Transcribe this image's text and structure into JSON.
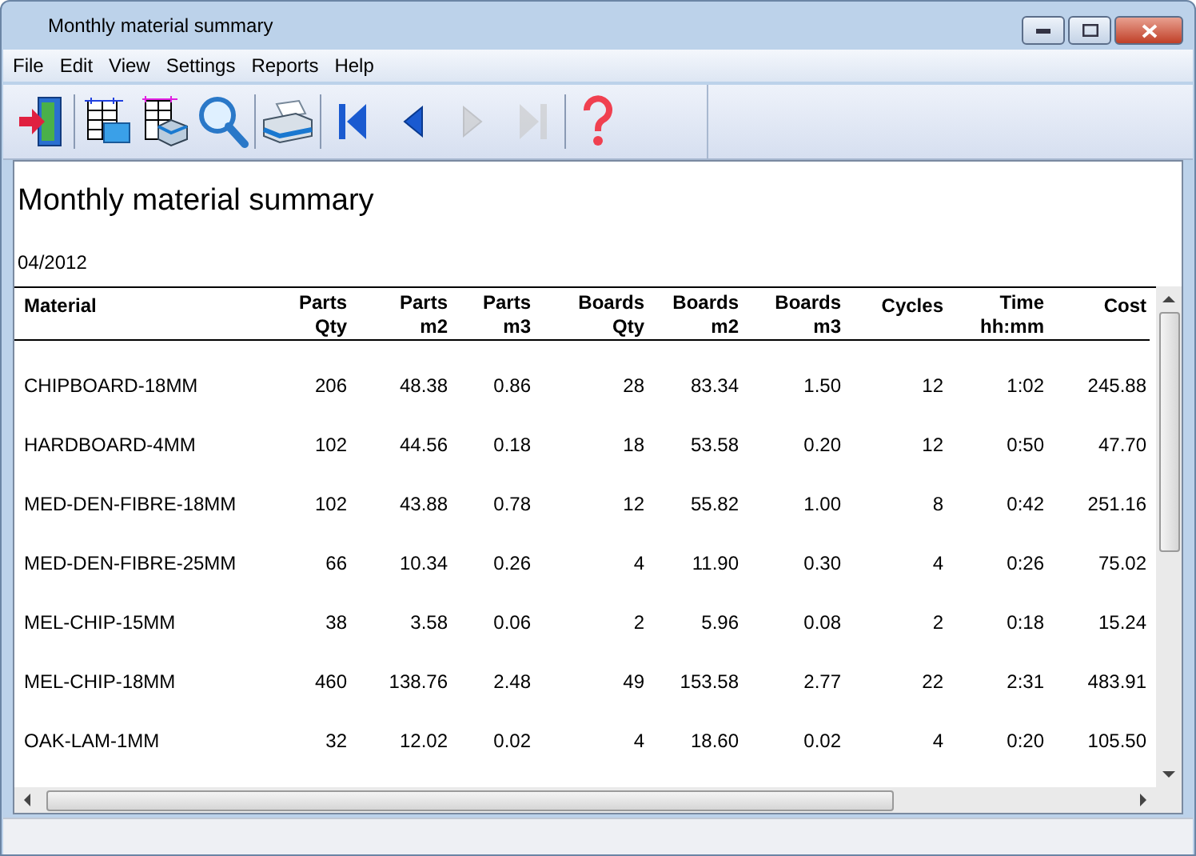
{
  "window": {
    "title": "Monthly material summary"
  },
  "menu": [
    "File",
    "Edit",
    "View",
    "Settings",
    "Reports",
    "Help"
  ],
  "toolbar": [
    {
      "kind": "exit",
      "disabled": false
    },
    {
      "kind": "separator"
    },
    {
      "kind": "layout",
      "disabled": false
    },
    {
      "kind": "preview",
      "disabled": false
    },
    {
      "kind": "zoom",
      "disabled": false
    },
    {
      "kind": "separator"
    },
    {
      "kind": "print",
      "disabled": false
    },
    {
      "kind": "separator"
    },
    {
      "kind": "first",
      "disabled": false
    },
    {
      "kind": "prev",
      "disabled": false
    },
    {
      "kind": "next",
      "disabled": true
    },
    {
      "kind": "last",
      "disabled": true
    },
    {
      "kind": "separator"
    },
    {
      "kind": "help",
      "disabled": false
    }
  ],
  "report": {
    "title": "Monthly material summary",
    "period": "04/2012",
    "columns": [
      "Material",
      "Parts Qty",
      "Parts m2",
      "Parts m3",
      "Boards Qty",
      "Boards m2",
      "Boards m3",
      "Cycles",
      "Time hh:mm",
      "Cost"
    ],
    "rows": [
      [
        "CHIPBOARD-18MM",
        "206",
        "48.38",
        "0.86",
        "28",
        "83.34",
        "1.50",
        "12",
        "1:02",
        "245.88"
      ],
      [
        "HARDBOARD-4MM",
        "102",
        "44.56",
        "0.18",
        "18",
        "53.58",
        "0.20",
        "12",
        "0:50",
        "47.70"
      ],
      [
        "MED-DEN-FIBRE-18MM",
        "102",
        "43.88",
        "0.78",
        "12",
        "55.82",
        "1.00",
        "8",
        "0:42",
        "251.16"
      ],
      [
        "MED-DEN-FIBRE-25MM",
        "66",
        "10.34",
        "0.26",
        "4",
        "11.90",
        "0.30",
        "4",
        "0:26",
        "75.02"
      ],
      [
        "MEL-CHIP-15MM",
        "38",
        "3.58",
        "0.06",
        "2",
        "5.96",
        "0.08",
        "2",
        "0:18",
        "15.24"
      ],
      [
        "MEL-CHIP-18MM",
        "460",
        "138.76",
        "2.48",
        "49",
        "153.58",
        "2.77",
        "22",
        "2:31",
        "483.91"
      ],
      [
        "OAK-LAM-1MM",
        "32",
        "12.02",
        "0.02",
        "4",
        "18.60",
        "0.02",
        "4",
        "0:20",
        "105.50"
      ]
    ]
  }
}
